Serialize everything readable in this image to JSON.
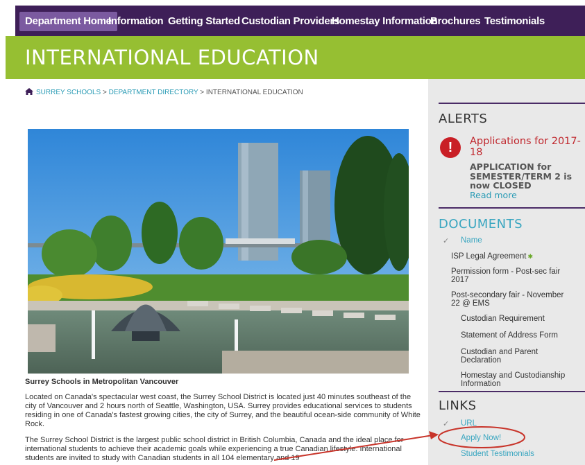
{
  "nav": {
    "items": [
      {
        "label": "Department Home",
        "active": true
      },
      {
        "label": "Information",
        "active": false
      },
      {
        "label": "Getting Started",
        "active": false
      },
      {
        "label": "Custodian Providers",
        "active": false
      },
      {
        "label": "Homestay Information",
        "active": false
      },
      {
        "label": "Brochures",
        "active": false
      },
      {
        "label": "Testimonials",
        "active": false
      }
    ]
  },
  "banner": {
    "title": "INTERNATIONAL EDUCATION"
  },
  "breadcrumb": {
    "home_icon": "home-icon",
    "items": [
      "SURREY SCHOOLS",
      "DEPARTMENT DIRECTORY",
      "INTERNATIONAL EDUCATION"
    ],
    "separator": ">"
  },
  "main": {
    "caption": "Surrey Schools in Metropolitan Vancouver",
    "paragraphs": [
      "Located on Canada's spectacular west coast, the Surrey School District is located just 40 minutes southeast of the city of Vancouver and 2 hours north of Seattle, Washington, USA. Surrey provides educational services to students residing in one of Canada's fastest growing cities, the city of Surrey, and the beautiful ocean-side community of White Rock.",
      "The Surrey School District is the largest public school district in British Columbia, Canada and the ideal place for international students to achieve their academic goals while experiencing a true Canadian lifestyle. International students are invited to study with Canadian students in all 104 elementary and 19"
    ]
  },
  "sidebar": {
    "alerts": {
      "heading": "ALERTS",
      "icon": "exclamation-icon",
      "title": "Applications for 2017-18",
      "body": "APPLICATION for SEMESTER/TERM 2 is now CLOSED",
      "read_more": "Read more"
    },
    "documents": {
      "heading": "DOCUMENTS",
      "sort_label": "Name",
      "items": [
        "ISP Legal Agreement",
        "Permission form - Post-sec fair 2017",
        "Post-secondary fair - November 22 @ EMS",
        "Custodian Requirement",
        "Statement of Address Form",
        "Custodian and Parent Declaration",
        "Homestay and Custodianship Information"
      ]
    },
    "links": {
      "heading": "LINKS",
      "sort_label": "URL",
      "items": [
        "Apply Now!",
        "Student Testimonials"
      ]
    }
  },
  "colors": {
    "nav_bg": "#3e1f58",
    "nav_active": "#7b5aa0",
    "banner": "#96bf32",
    "teal_link": "#2a9bb5",
    "alert_red": "#c91f26",
    "annotation_red": "#c8342a"
  }
}
